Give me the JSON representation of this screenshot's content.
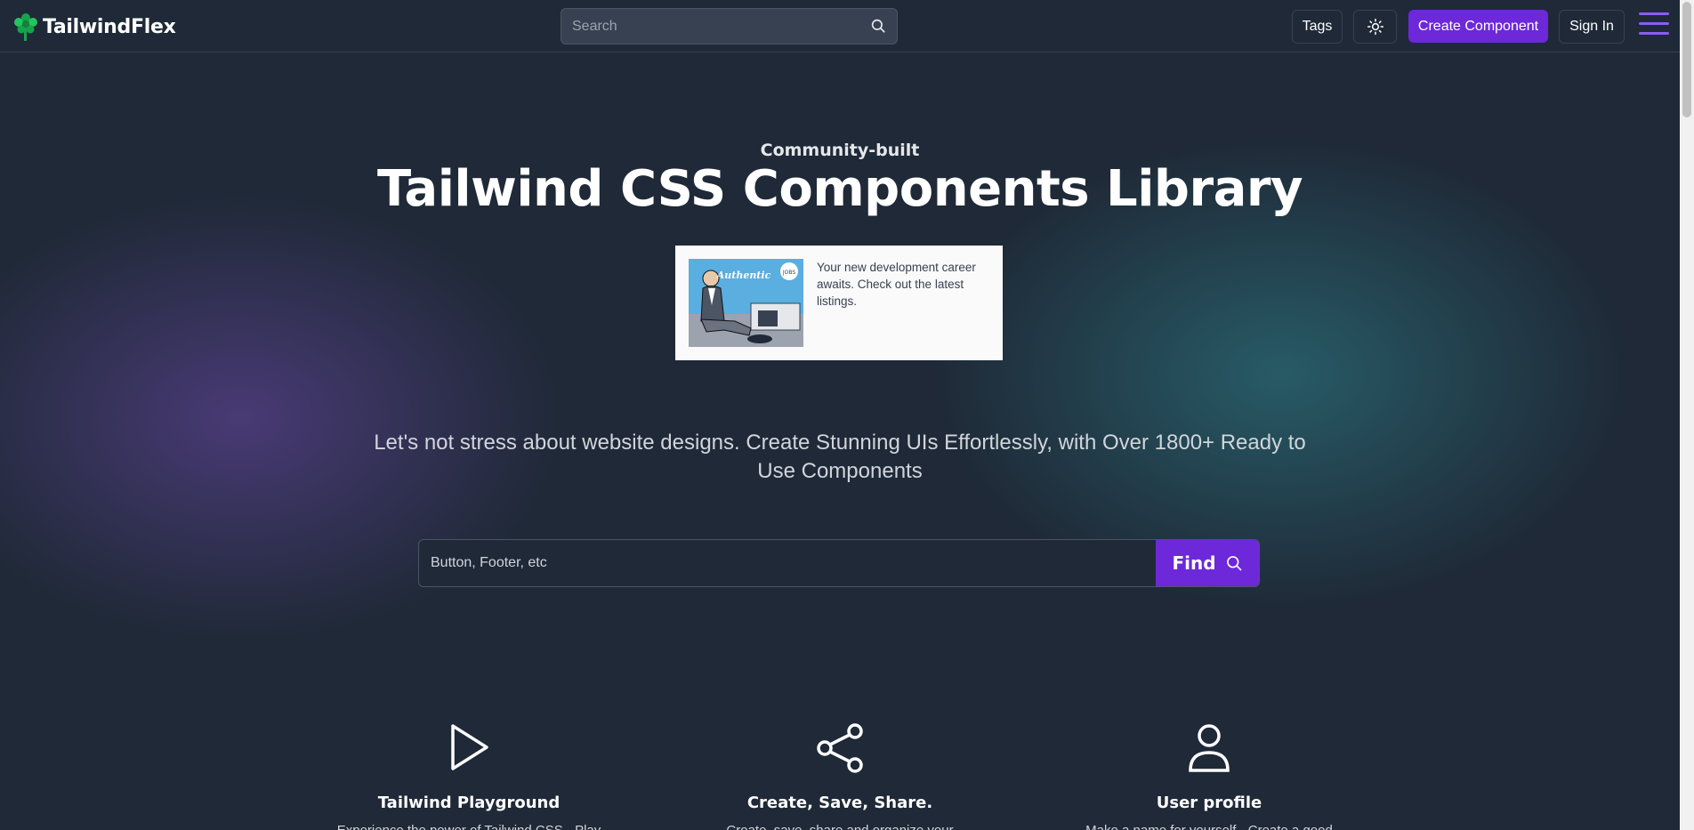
{
  "header": {
    "brand": "TailwindFlex",
    "search_placeholder": "Search",
    "tags_label": "Tags",
    "create_label": "Create Component",
    "signin_label": "Sign In"
  },
  "hero": {
    "eyebrow": "Community-built",
    "title": "Tailwind CSS Components Library",
    "tagline": "Let's not stress about website designs. Create Stunning UIs Effortlessly, with Over 1800+ Ready to Use Components",
    "find_placeholder": "Button, Footer, etc",
    "find_label": "Find"
  },
  "ad": {
    "text": "Your new development career awaits. Check out the latest listings.",
    "image_brand": "Authentic",
    "image_badge": "JOBS"
  },
  "features": [
    {
      "title": "Tailwind Playground",
      "desc": "Experience the power of Tailwind CSS - Play",
      "icon": "play-icon"
    },
    {
      "title": "Create, Save, Share.",
      "desc": "Create, save, share and organize your",
      "icon": "share-icon"
    },
    {
      "title": "User profile",
      "desc": "Make a name for yourself - Create a good",
      "icon": "user-icon"
    }
  ],
  "colors": {
    "background": "#1f2937",
    "accent": "#6d28d9",
    "menu": "#8b5cf6"
  }
}
